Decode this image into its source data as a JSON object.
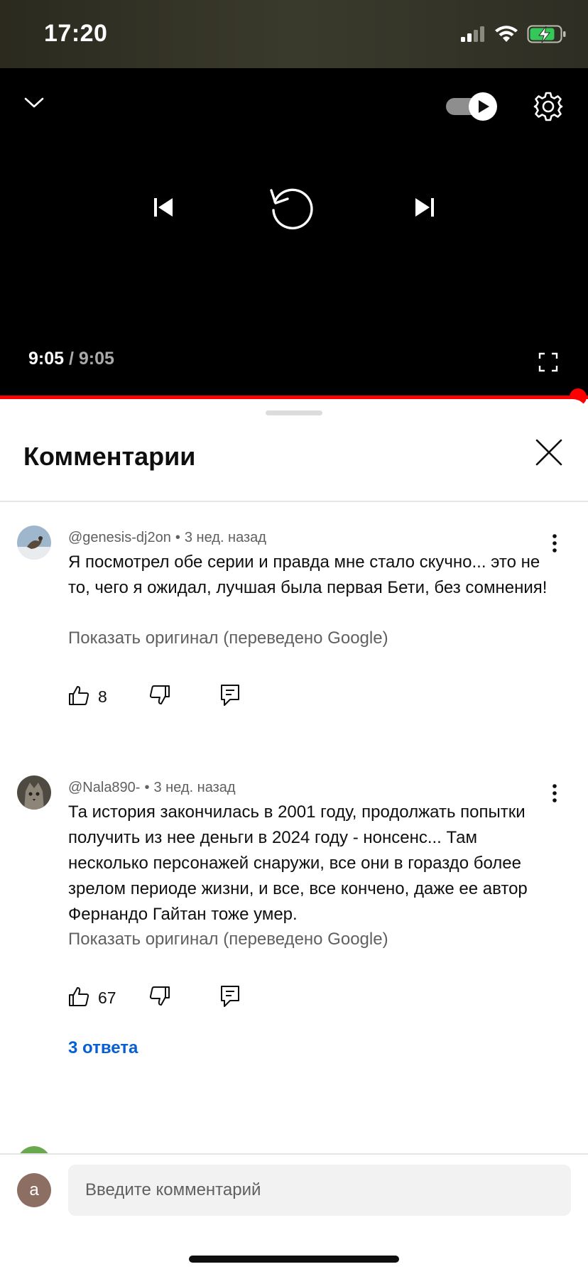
{
  "status_bar": {
    "time": "17:20",
    "icons": [
      "cellular-signal-icon",
      "wifi-icon",
      "battery-charging-icon"
    ],
    "battery_color": "#34c759"
  },
  "player": {
    "current_time": "9:05",
    "separator": "/",
    "duration": "9:05",
    "autoplay_enabled": true,
    "progress_fraction": 1.0,
    "accent_color": "#ff0000",
    "icons": {
      "collapse": "chevron-down-icon",
      "autoplay": "autoplay-toggle-icon",
      "settings": "gear-icon",
      "previous": "skip-previous-icon",
      "replay": "replay-icon",
      "next": "skip-next-icon",
      "fullscreen": "fullscreen-icon"
    }
  },
  "comments_panel": {
    "title": "Комментарии",
    "close_icon": "close-icon",
    "comments": [
      {
        "author": "@genesis-dj2on",
        "dot": "•",
        "age": "3 нед. назад",
        "text": "Я посмотрел обе серии и правда мне стало скучно... это не то, чего я ожидал, лучшая была первая Бети, без сомнения!",
        "translate_label": "Показать оригинал (переведено Google)",
        "likes": "8"
      },
      {
        "author": "@Nala890-",
        "dot": "•",
        "age": "3 нед. назад",
        "text": "Та история закончилась в 2001 году, продолжать попытки получить из нее деньги в 2024 году - нонсенс... Там несколько персонажей снаружи, все они в гораздо более зрелом периоде жизни, и все, все кончено, даже ее автор Фернандо Гайтан тоже умер.",
        "translate_label": "Показать оригинал (переведено Google)",
        "likes": "67",
        "replies_label": "3 ответа"
      }
    ],
    "action_icons": [
      "thumbs-up-icon",
      "thumbs-down-icon",
      "reply-icon"
    ],
    "link_color": "#065fd4"
  },
  "comment_input": {
    "user_initial": "a",
    "placeholder": "Введите комментарий",
    "value": ""
  }
}
